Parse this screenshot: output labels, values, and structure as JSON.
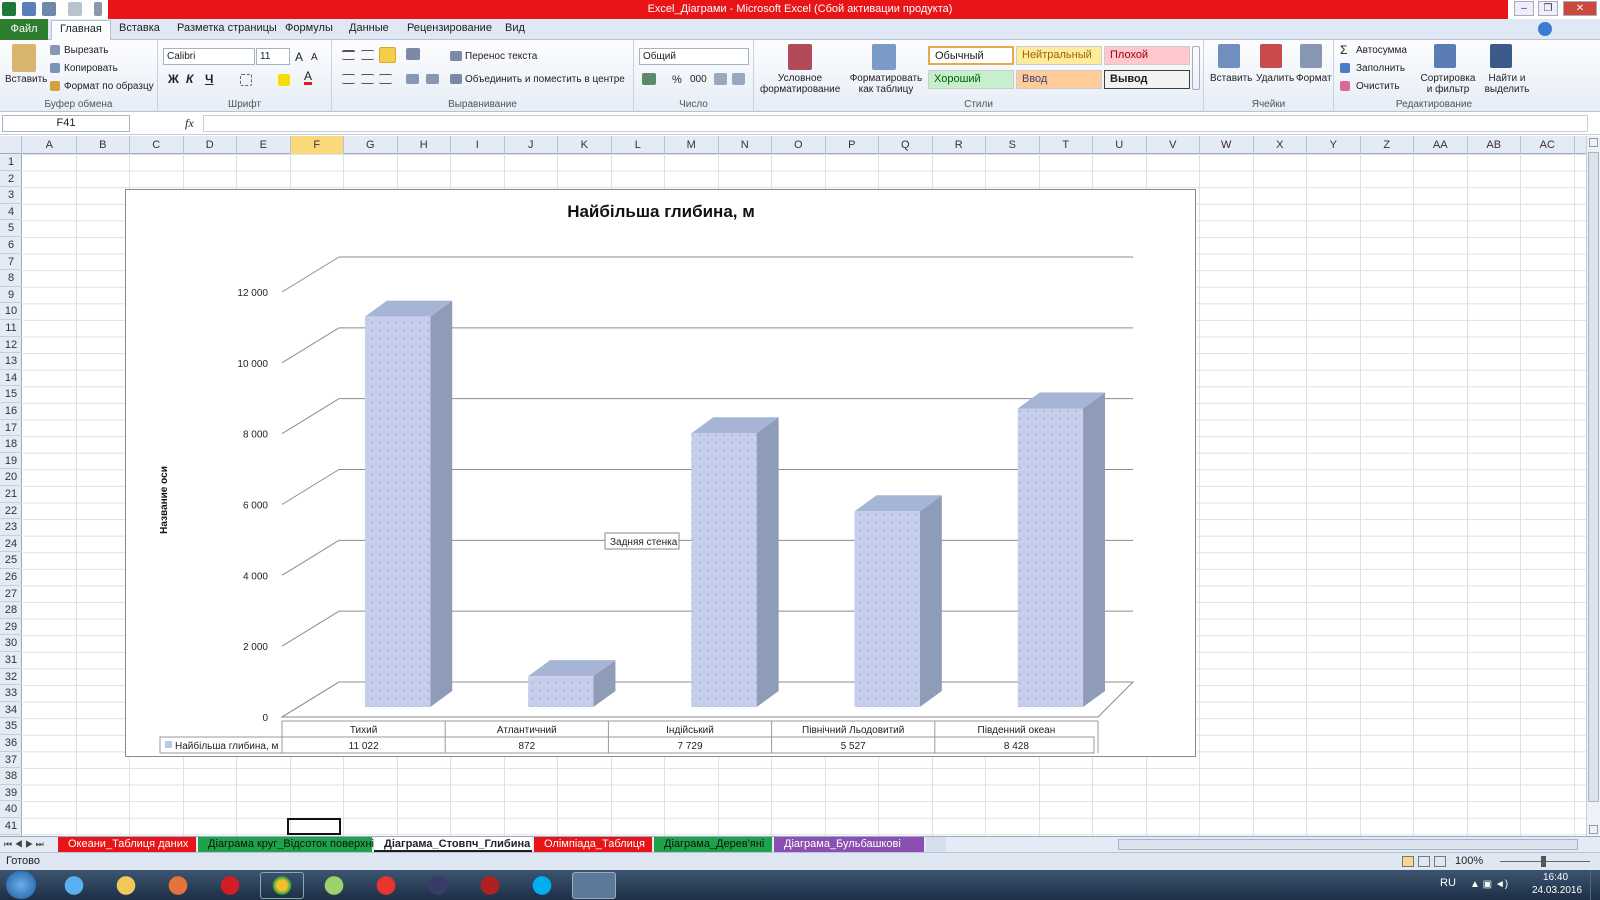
{
  "window": {
    "title": "Excel_Діаграми  -  Microsoft Excel (Сбой активации продукта)"
  },
  "ribbon_tabs": [
    "Файл",
    "Главная",
    "Вставка",
    "Разметка страницы",
    "Формулы",
    "Данные",
    "Рецензирование",
    "Вид"
  ],
  "ribbon": {
    "clipboard": {
      "paste": "Вставить",
      "cut": "Вырезать",
      "copy": "Копировать",
      "format_painter": "Формат по образцу",
      "label": "Буфер обмена"
    },
    "font": {
      "name": "Calibri",
      "size": "11",
      "bold": "Ж",
      "italic": "К",
      "underline": "Ч",
      "label": "Шрифт"
    },
    "alignment": {
      "wrap": "Перенос текста",
      "merge": "Объединить и поместить в центре",
      "label": "Выравнивание"
    },
    "number": {
      "format": "Общий",
      "percent": "%",
      "thousands": "000",
      "label": "Число"
    },
    "styles": {
      "conditional": "Условное форматирование",
      "as_table": "Форматировать как таблицу",
      "normal": "Обычный",
      "neutral": "Нейтральный",
      "bad": "Плохой",
      "good": "Хороший",
      "input": "Ввод",
      "output": "Вывод",
      "label": "Стили"
    },
    "cells": {
      "insert": "Вставить",
      "delete": "Удалить",
      "format": "Формат",
      "label": "Ячейки"
    },
    "editing": {
      "autosum": "Автосумма",
      "fill": "Заполнить",
      "clear": "Очистить",
      "sort": "Сортировка и фильтр",
      "find": "Найти и выделить",
      "label": "Редактирование"
    }
  },
  "formula_bar": {
    "cell_ref": "F41",
    "fx": "fx",
    "value": ""
  },
  "columns": [
    "A",
    "B",
    "C",
    "D",
    "E",
    "F",
    "G",
    "H",
    "I",
    "J",
    "K",
    "L",
    "M",
    "N",
    "O",
    "P",
    "Q",
    "R",
    "S",
    "T",
    "U",
    "V",
    "W",
    "X",
    "Y",
    "Z",
    "AA",
    "AB",
    "AC"
  ],
  "selected_column": "F",
  "rows": [
    "1",
    "2",
    "3",
    "4",
    "5",
    "6",
    "7",
    "8",
    "9",
    "10",
    "11",
    "12",
    "13",
    "14",
    "15",
    "16",
    "17",
    "18",
    "19",
    "20",
    "21",
    "22",
    "23",
    "24",
    "25",
    "26",
    "27",
    "28",
    "29",
    "30",
    "31",
    "32",
    "33",
    "34",
    "35",
    "36",
    "37",
    "38",
    "39",
    "40",
    "41"
  ],
  "chart_data": {
    "type": "bar",
    "title": "Найбільша глибина, м",
    "ylabel": "Название оси",
    "xlabel": "",
    "categories": [
      "Тихий",
      "Атлантичний",
      "Індійський",
      "Північний Льодовитий",
      "Південний океан"
    ],
    "series": [
      {
        "name": "Найбільша глибина, м",
        "values": [
          11022,
          872,
          7729,
          5527,
          8428
        ]
      }
    ],
    "value_labels": [
      "11 022",
      "872",
      "7 729",
      "5 527",
      "8 428"
    ],
    "yticks": [
      "0",
      "2 000",
      "4 000",
      "6 000",
      "8 000",
      "10 000",
      "12 000"
    ],
    "ylim": [
      0,
      12000
    ],
    "grid": true,
    "data_table": true,
    "tooltip": "Задняя стенка",
    "bar_color": "#b9c9ea"
  },
  "sheet_tabs": [
    {
      "label": "Океани_Таблиця даних",
      "color": "#e81417"
    },
    {
      "label": "Діаграма круг_Відсоток поверхні",
      "color": "#1fa34a"
    },
    {
      "label": "Діаграма_Стовпч_Глибина",
      "color": "#ffffff",
      "active": true
    },
    {
      "label": "Олімпіада_Таблиця",
      "color": "#e81417"
    },
    {
      "label": "Діаграма_Дерев'яні",
      "color": "#1fa34a"
    },
    {
      "label": "Діаграма_Бульбашкові",
      "color": "#8a4fb0"
    }
  ],
  "status": {
    "text": "Готово",
    "zoom": "100%"
  },
  "taskbar": {
    "lang": "RU",
    "time": "16:40",
    "date": "24.03.2016"
  }
}
